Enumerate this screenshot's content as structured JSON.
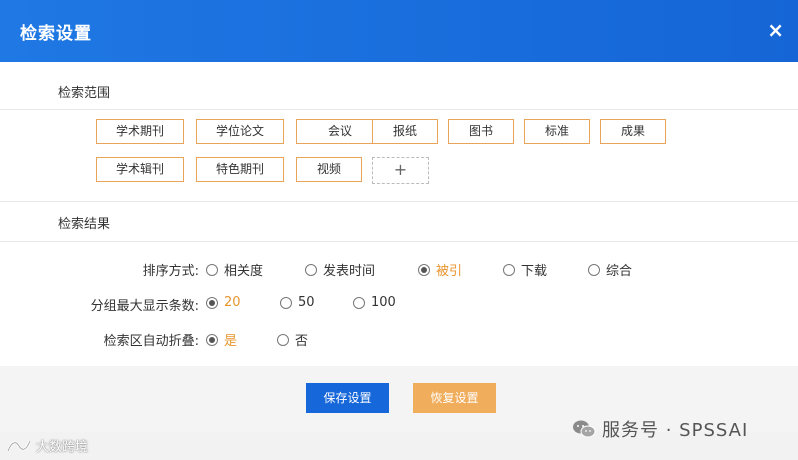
{
  "dialog": {
    "title": "检索设置",
    "close_glyph": "×"
  },
  "scope": {
    "title": "检索范围",
    "tags": [
      "学术期刊",
      "学位论文",
      "会议",
      "报纸",
      "图书",
      "标准",
      "成果",
      "学术辑刊",
      "特色期刊",
      "视频"
    ],
    "add_glyph": "+"
  },
  "results": {
    "title": "检索结果",
    "sort": {
      "label": "排序方式:",
      "options": [
        "相关度",
        "发表时间",
        "被引",
        "下载",
        "综合"
      ],
      "selected": "被引"
    },
    "group_max": {
      "label": "分组最大显示条数:",
      "options": [
        "20",
        "50",
        "100"
      ],
      "selected": "20"
    },
    "auto_fold": {
      "label": "检索区自动折叠:",
      "options": [
        "是",
        "否"
      ],
      "selected": "是"
    }
  },
  "footer": {
    "save_label": "保存设置",
    "reset_label": "恢复设置"
  },
  "watermark": {
    "right_text": "服务号 · SPSSAI",
    "left_text": "大数跨境"
  },
  "colors": {
    "header": "#1f78e4",
    "accent": "#e8952e",
    "save": "#1667d9",
    "reset": "#f0ad5b"
  }
}
